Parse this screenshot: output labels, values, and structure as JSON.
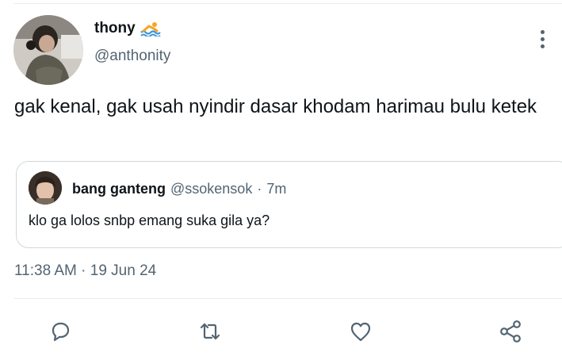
{
  "tweet": {
    "author": {
      "display_name": "thony",
      "name_emoji_icon": "swimmer-icon",
      "handle": "@anthonity",
      "avatar_icon": "profile-photo"
    },
    "text": "gak kenal, gak usah nyindir dasar khodam harimau bulu ketek",
    "timestamp": "11:38 AM · 19 Jun 24",
    "more_icon": "vertical-ellipsis-icon"
  },
  "quoted_tweet": {
    "display_name": "bang ganteng",
    "handle": "@ssokensok",
    "separator": "·",
    "time_ago": "7m",
    "text": "klo ga lolos snbp emang suka gila ya?",
    "avatar_icon": "profile-photo"
  },
  "actions": [
    {
      "name": "reply",
      "icon": "speech-bubble-icon"
    },
    {
      "name": "retweet",
      "icon": "retweet-icon"
    },
    {
      "name": "like",
      "icon": "heart-icon"
    },
    {
      "name": "share",
      "icon": "share-icon"
    }
  ],
  "colors": {
    "text_primary": "#0f1419",
    "text_secondary": "#536471",
    "border": "#cfd9de",
    "divider": "#e6ecf0"
  }
}
